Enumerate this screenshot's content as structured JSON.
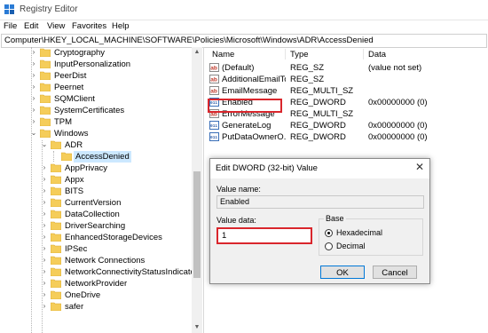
{
  "window": {
    "title": "Registry Editor"
  },
  "menu": [
    "File",
    "Edit",
    "View",
    "Favorites",
    "Help"
  ],
  "address": "Computer\\HKEY_LOCAL_MACHINE\\SOFTWARE\\Policies\\Microsoft\\Windows\\ADR\\AccessDenied",
  "tree": [
    {
      "label": "Cryptography"
    },
    {
      "label": "InputPersonalization"
    },
    {
      "label": "PeerDist"
    },
    {
      "label": "Peernet"
    },
    {
      "label": "SQMClient"
    },
    {
      "label": "SystemCertificates"
    },
    {
      "label": "TPM"
    },
    {
      "label": "Windows"
    },
    {
      "label": "ADR"
    },
    {
      "label": "AccessDenied"
    },
    {
      "label": "AppPrivacy"
    },
    {
      "label": "Appx"
    },
    {
      "label": "BITS"
    },
    {
      "label": "CurrentVersion"
    },
    {
      "label": "DataCollection"
    },
    {
      "label": "DriverSearching"
    },
    {
      "label": "EnhancedStorageDevices"
    },
    {
      "label": "IPSec"
    },
    {
      "label": "Network Connections"
    },
    {
      "label": "NetworkConnectivityStatusIndicator"
    },
    {
      "label": "NetworkProvider"
    },
    {
      "label": "OneDrive"
    },
    {
      "label": "safer"
    }
  ],
  "columns": {
    "name": "Name",
    "type": "Type",
    "data": "Data"
  },
  "values": [
    {
      "name": "(Default)",
      "type": "REG_SZ",
      "data": "(value not set)",
      "icon": "string-value-icon"
    },
    {
      "name": "AdditionalEmailTo",
      "type": "REG_SZ",
      "data": "",
      "icon": "string-value-icon"
    },
    {
      "name": "EmailMessage",
      "type": "REG_MULTI_SZ",
      "data": "",
      "icon": "string-value-icon"
    },
    {
      "name": "Enabled",
      "type": "REG_DWORD",
      "data": "0x00000000 (0)",
      "icon": "dword-value-icon"
    },
    {
      "name": "ErrorMessage",
      "type": "REG_MULTI_SZ",
      "data": "",
      "icon": "string-value-icon"
    },
    {
      "name": "GenerateLog",
      "type": "REG_DWORD",
      "data": "0x00000000 (0)",
      "icon": "dword-value-icon"
    },
    {
      "name": "PutDataOwnerO...",
      "type": "REG_DWORD",
      "data": "0x00000000 (0)",
      "icon": "dword-value-icon"
    }
  ],
  "dialog": {
    "title": "Edit DWORD (32-bit) Value",
    "value_name_label": "Value name:",
    "value_name": "Enabled",
    "value_data_label": "Value data:",
    "value_data": "1",
    "base_label": "Base",
    "hex_label": "Hexadecimal",
    "dec_label": "Decimal",
    "ok_label": "OK",
    "cancel_label": "Cancel",
    "close_glyph": "✕"
  },
  "colors": {
    "highlight_red": "#d9262c",
    "selection_blue": "#cce8ff",
    "folder_yellow": "#f5cd5a"
  }
}
